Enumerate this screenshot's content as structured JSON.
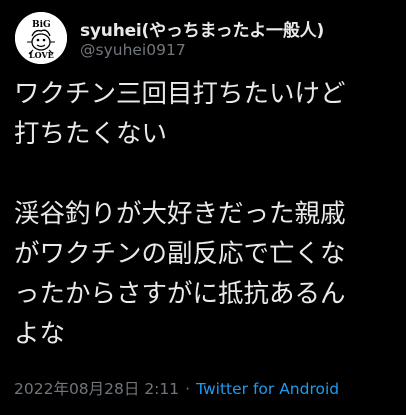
{
  "tweet": {
    "display_name": "syuhei(やっちまったよ一般人)",
    "handle": "@syuhei0917",
    "avatar_text": {
      "top": "BiG",
      "bottom": "LOVE"
    },
    "lines": [
      "ワクチン三回目打ちたいけど",
      "打ちたくない",
      "",
      "渓谷釣りが大好きだった親戚",
      "がワクチンの副反応で亡くな",
      "ったからさすがに抵抗あるん",
      "よな"
    ],
    "date": "2022年08月28日 2:11",
    "separator": "·",
    "source": "Twitter for Android"
  },
  "colors": {
    "background": "#000000",
    "primary_text": "#e7e9ea",
    "secondary_text": "#71767b",
    "link": "#1d9bf0"
  }
}
